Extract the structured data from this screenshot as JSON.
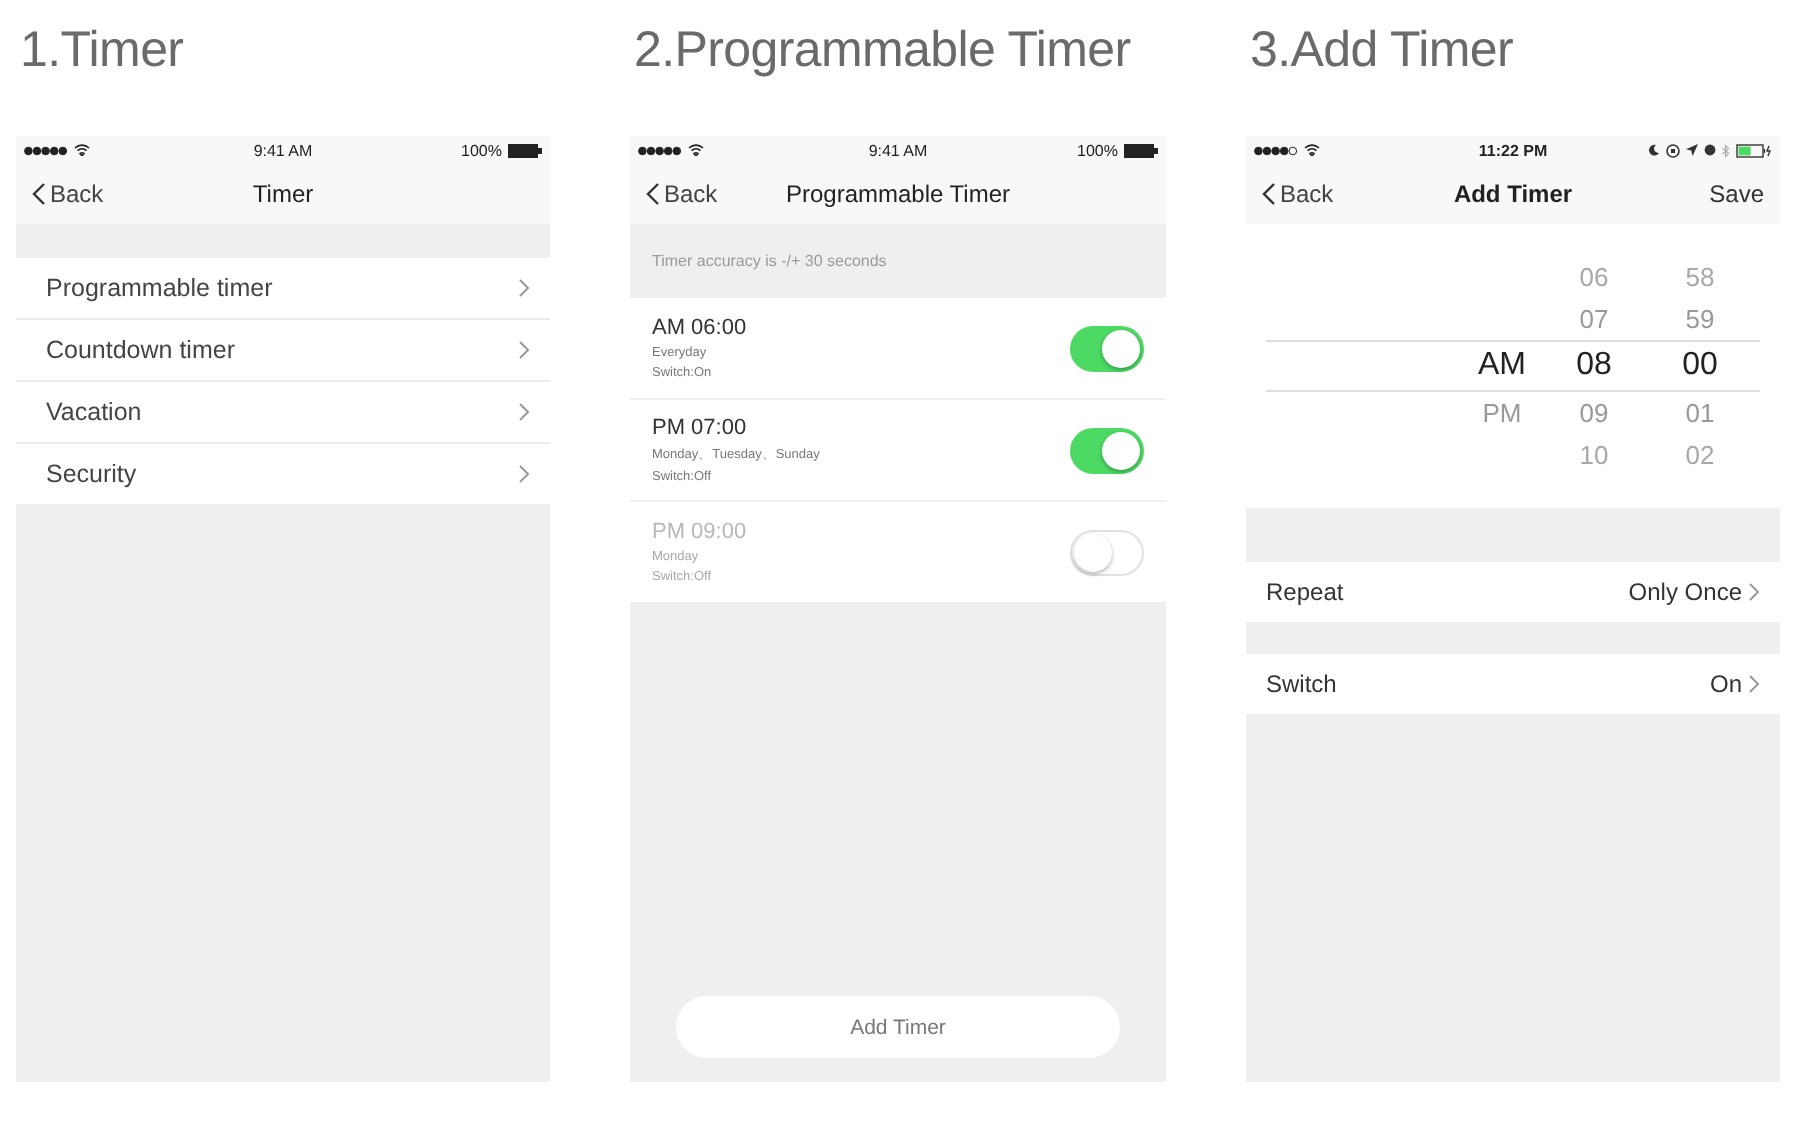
{
  "screens": [
    {
      "heading": "1.Timer",
      "kind": "menu",
      "status_bar": {
        "kind": "basic",
        "time": "9:41 AM",
        "battery": "100%"
      },
      "nav": {
        "back": "Back",
        "title": "Timer"
      },
      "items": [
        "Programmable timer",
        "Countdown timer",
        "Vacation",
        "Security"
      ]
    },
    {
      "heading": "2.Programmable Timer",
      "kind": "timers",
      "status_bar": {
        "kind": "basic",
        "time": "9:41 AM",
        "battery": "100%"
      },
      "nav": {
        "back": "Back",
        "title": "Programmable Timer"
      },
      "note": "Timer accuracy is -/+ 30 seconds",
      "timers": [
        {
          "time": "AM 06:00",
          "days": "Everyday",
          "switch": "Switch:On",
          "on": true,
          "disabled": false
        },
        {
          "time": "PM 07:00",
          "days": "Monday、Tuesday、Sunday",
          "switch": "Switch:Off",
          "on": true,
          "disabled": false
        },
        {
          "time": "PM 09:00",
          "days": "Monday",
          "switch": "Switch:Off",
          "on": false,
          "disabled": true
        }
      ],
      "button": "Add Timer"
    },
    {
      "heading": "3.Add Timer",
      "kind": "add",
      "status_bar": {
        "kind": "full",
        "time": "11:22 PM"
      },
      "nav": {
        "back": "Back",
        "title": "Add Timer",
        "action": "Save"
      },
      "picker": {
        "columns": [
          [
            {
              "value": "AM",
              "selected": true
            },
            {
              "value": "PM",
              "selected": false
            }
          ],
          [
            {
              "value": "06",
              "selected": false
            },
            {
              "value": "07",
              "selected": false
            },
            {
              "value": "08",
              "selected": true
            },
            {
              "value": "09",
              "selected": false
            },
            {
              "value": "10",
              "selected": false
            }
          ],
          [
            {
              "value": "58",
              "selected": false
            },
            {
              "value": "59",
              "selected": false
            },
            {
              "value": "00",
              "selected": true
            },
            {
              "value": "01",
              "selected": false
            },
            {
              "value": "02",
              "selected": false
            }
          ]
        ]
      },
      "settings": [
        {
          "label": "Repeat",
          "value": "Only Once"
        },
        {
          "label": "Switch",
          "value": "On"
        }
      ]
    }
  ]
}
